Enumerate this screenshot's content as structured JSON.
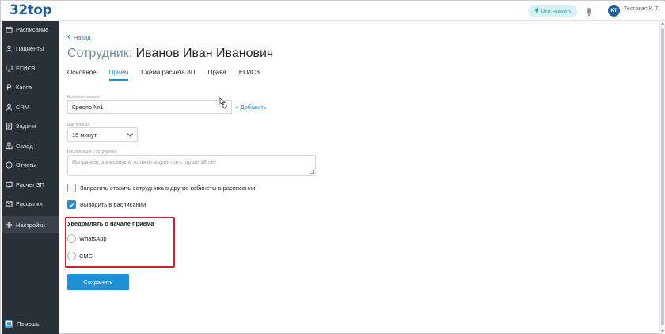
{
  "app": {
    "logo": "32top"
  },
  "topbar": {
    "whats_new": "Что нового",
    "whats_new_icon": "lightning-icon",
    "bell_icon": "bell-icon",
    "avatar_initials": "КТ",
    "user_name": "Тестовая К. Т."
  },
  "sidebar": {
    "items": [
      {
        "label": "Расписание",
        "icon": "calendar-icon"
      },
      {
        "label": "Пациенты",
        "icon": "person-icon"
      },
      {
        "label": "ЕГИСЗ",
        "icon": "monitor-icon"
      },
      {
        "label": "Касса",
        "icon": "ruble-icon"
      },
      {
        "label": "CRM",
        "icon": "person-icon"
      },
      {
        "label": "Задачи",
        "icon": "tasks-icon"
      },
      {
        "label": "Склад",
        "icon": "boxes-icon"
      },
      {
        "label": "Отчеты",
        "icon": "pie-icon"
      },
      {
        "label": "Расчет ЗП",
        "icon": "monitor-icon"
      },
      {
        "label": "Рассылки",
        "icon": "mail-icon"
      },
      {
        "label": "Настройки",
        "icon": "gear-icon"
      }
    ],
    "active_item": "Настройки",
    "help": "Помощь"
  },
  "main": {
    "back": "Назад",
    "title_prefix": "Сотрудник:",
    "title_name": "Иванов Иван Иванович",
    "tabs": [
      {
        "label": "Основное"
      },
      {
        "label": "Прием"
      },
      {
        "label": "Схема расчета ЗП"
      },
      {
        "label": "Права"
      },
      {
        "label": "ЕГИСЗ"
      }
    ],
    "active_tab": "Прием",
    "chair": {
      "label": "Выберите кресло *",
      "value": "Кресло №1",
      "add": "+ Добавить"
    },
    "step": {
      "label": "Шаг приема",
      "value": "15 минут"
    },
    "info": {
      "label": "Информация о сотруднике",
      "placeholder": "Например, записывать только пациентов старше 18 лет"
    },
    "forbid_cabinets": {
      "label": "Запретить ставить сотрудника в другие кабинеты в расписании",
      "checked": false
    },
    "show_in_schedule": {
      "label": "Выводить в расписании",
      "checked": true
    },
    "notify": {
      "title": "Уведомлять о начале приема",
      "options": [
        {
          "label": "WhatsApp",
          "selected": false
        },
        {
          "label": "СМС",
          "selected": false
        }
      ]
    },
    "save": "Сохранить"
  },
  "colors": {
    "accent": "#1f8fd6",
    "sidebar_bg": "#2a3038",
    "highlight": "#d0222a",
    "logo": "#1f5d9e"
  }
}
